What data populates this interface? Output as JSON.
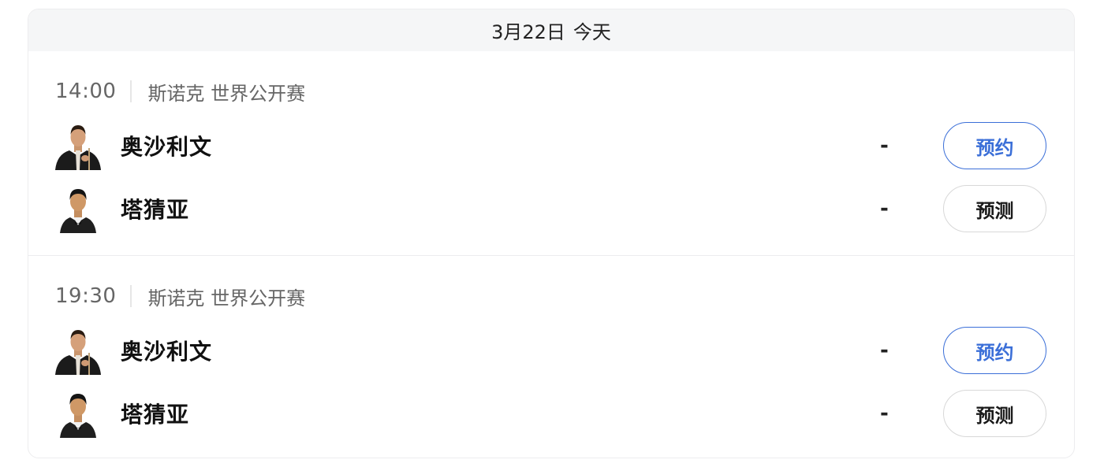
{
  "day_header": {
    "date": "3月22日",
    "day_label": "今天"
  },
  "matches": [
    {
      "time": "14:00",
      "league": "斯诺克 世界公开赛",
      "players": [
        {
          "name": "奥沙利文",
          "score": "-",
          "action": "预约",
          "avatar_icon": "player-photo-osullivan"
        },
        {
          "name": "塔猜亚",
          "score": "-",
          "action": "预测",
          "avatar_icon": "player-photo-thepchaiya"
        }
      ]
    },
    {
      "time": "19:30",
      "league": "斯诺克 世界公开赛",
      "players": [
        {
          "name": "奥沙利文",
          "score": "-",
          "action": "预约",
          "avatar_icon": "player-photo-osullivan"
        },
        {
          "name": "塔猜亚",
          "score": "-",
          "action": "预测",
          "avatar_icon": "player-photo-thepchaiya"
        }
      ]
    }
  ],
  "colors": {
    "accent": "#3b6fd8",
    "header_bg": "#f5f6f7",
    "muted_text": "#666666",
    "border": "#ececee"
  }
}
